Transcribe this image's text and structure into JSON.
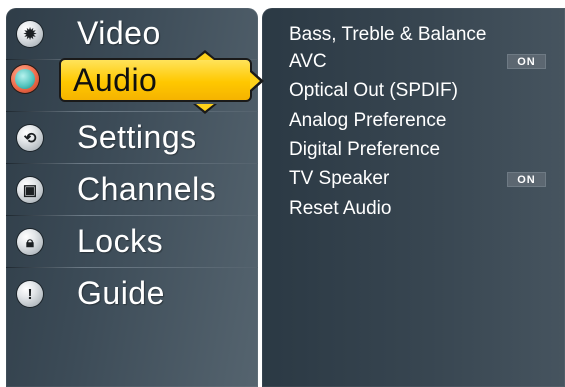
{
  "main_menu": {
    "items": [
      {
        "label": "Video",
        "icon": "gear-icon"
      },
      {
        "label": "Audio",
        "icon": "speaker-icon",
        "selected": true
      },
      {
        "label": "Settings",
        "icon": "settings-icon"
      },
      {
        "label": "Channels",
        "icon": "tv-icon"
      },
      {
        "label": "Locks",
        "icon": "lock-icon"
      },
      {
        "label": "Guide",
        "icon": "info-icon"
      }
    ],
    "selection_color": "#FFC800"
  },
  "audio_submenu": {
    "items": [
      {
        "label": "Bass, Treble & Balance"
      },
      {
        "label": "AVC",
        "status": "ON"
      },
      {
        "label": "Optical Out (SPDIF)"
      },
      {
        "label": "Analog Preference"
      },
      {
        "label": "Digital Preference"
      },
      {
        "label": "TV Speaker",
        "status": "ON"
      },
      {
        "label": "Reset Audio"
      }
    ]
  }
}
